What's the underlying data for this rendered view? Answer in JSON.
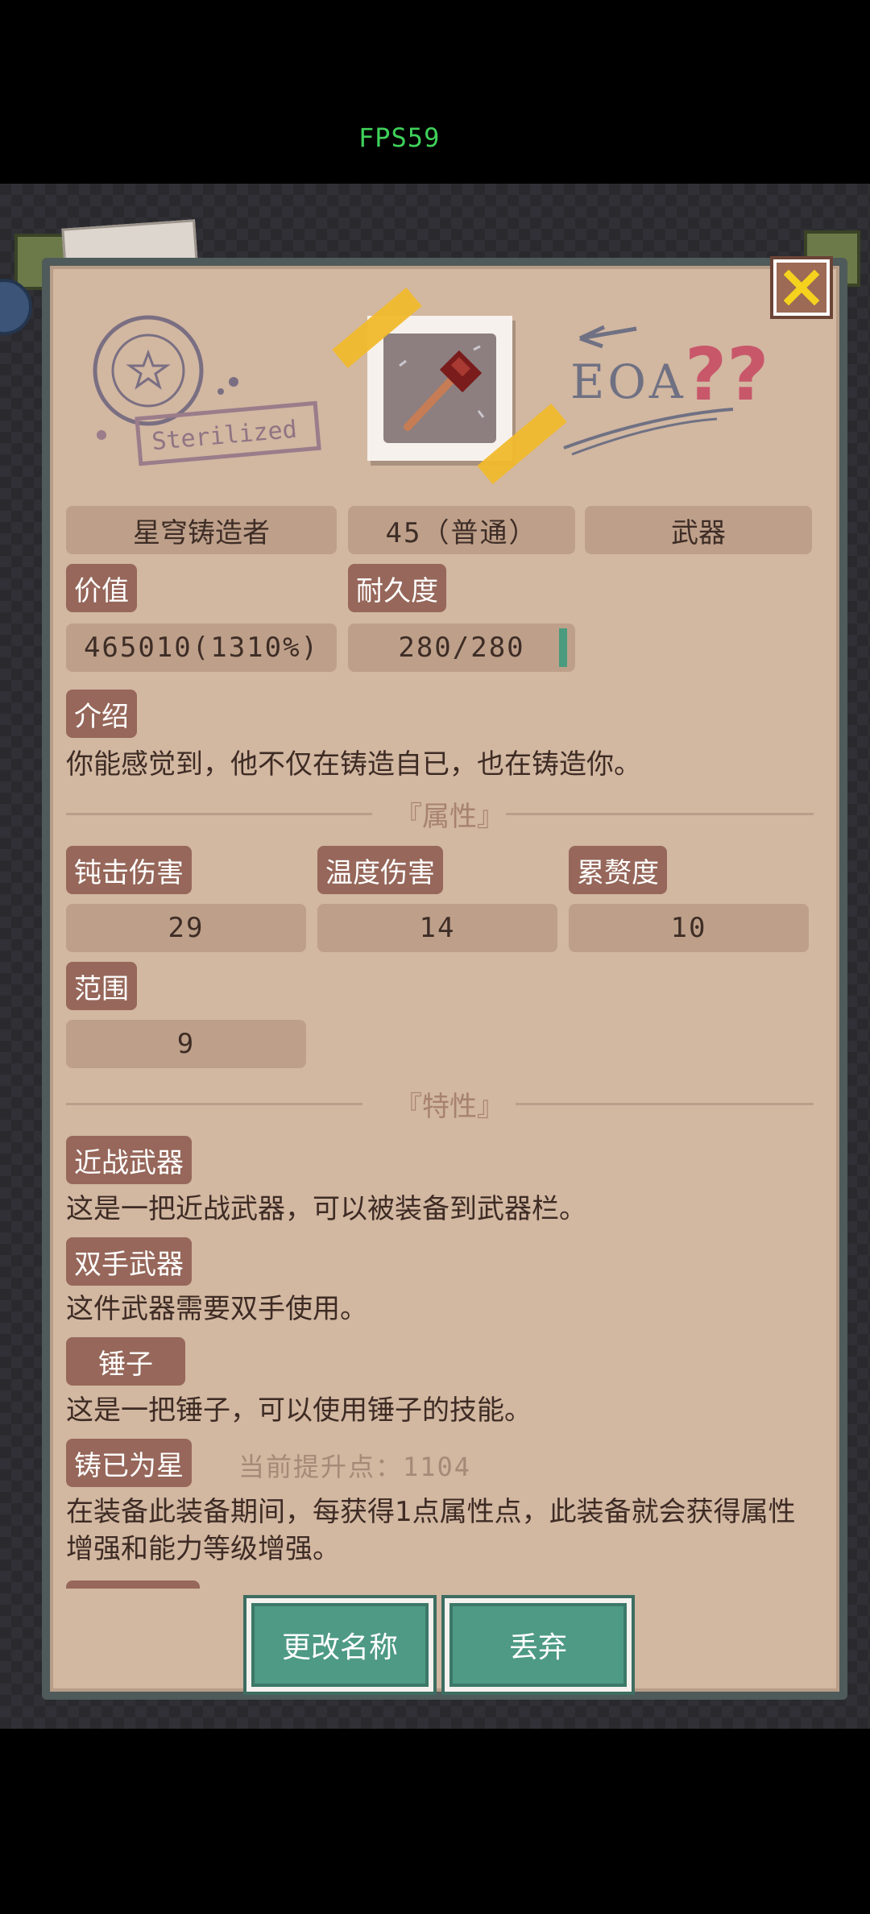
{
  "status": {
    "fps": "FPS59"
  },
  "header": {
    "stamp_left_text": "Sterilized",
    "stamp_left_ring": "SPECIAL",
    "stamp_right_text": "EOA"
  },
  "item": {
    "name": "星穹铸造者",
    "level": "45（普通）",
    "category": "武器",
    "value_label": "价值",
    "value": "465010(1310%)",
    "durability_label": "耐久度",
    "durability": "280/280",
    "durability_fraction": 1.0,
    "intro_label": "介绍",
    "intro_text": "你能感觉到，他不仅在铸造自已，也在铸造你。"
  },
  "attributes": {
    "title": "『属性』",
    "items": [
      {
        "label": "钝击伤害",
        "value": "29"
      },
      {
        "label": "温度伤害",
        "value": "14"
      },
      {
        "label": "累赘度",
        "value": "10"
      },
      {
        "label": "范围",
        "value": "9"
      }
    ]
  },
  "traits": {
    "title": "『特性』",
    "items": [
      {
        "label": "近战武器",
        "text": "这是一把近战武器，可以被装备到武器栏。"
      },
      {
        "label": "双手武器",
        "text": "这件武器需要双手使用。"
      },
      {
        "label": "锤子",
        "text": "这是一把锤子，可以使用锤子的技能。"
      },
      {
        "label": "铸已为星",
        "extra": "当前提升点：1104",
        "text": "在装备此装备期间，每获得1点属性点，此装备就会获得属性增强和能力等级增强。"
      }
    ]
  },
  "actions": {
    "rename": "更改名称",
    "discard": "丢弃"
  },
  "colors": {
    "panel": "#d2b7a1",
    "tag": "#96675a",
    "button": "#4e9a84",
    "close": "#f5d21e"
  }
}
